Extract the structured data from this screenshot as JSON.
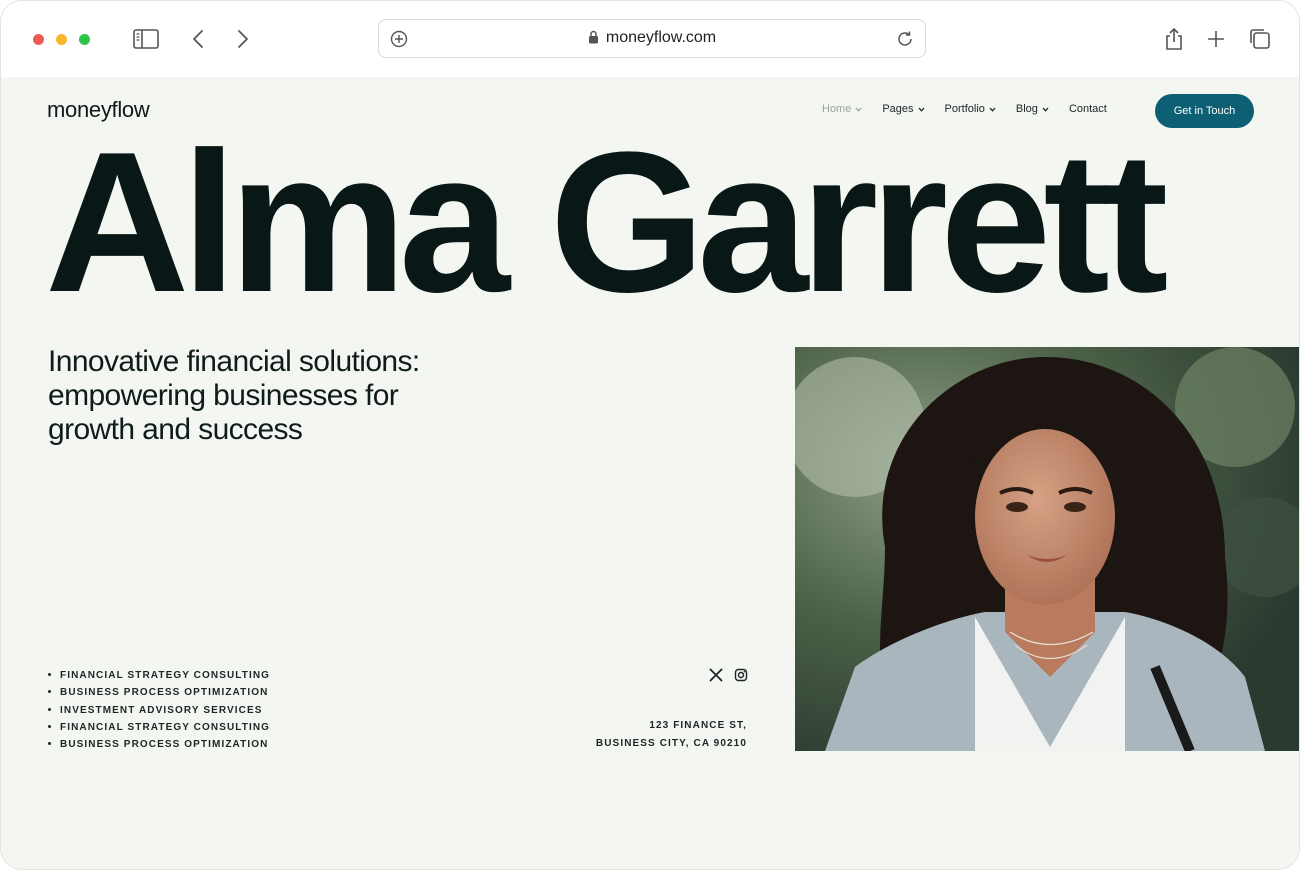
{
  "browser": {
    "url": "moneyflow.com",
    "traffic_colors": [
      "#ee5b52",
      "#f6b72c",
      "#2fc548"
    ]
  },
  "site": {
    "logo": "moneyflow",
    "nav": [
      {
        "label": "Home",
        "dropdown": true,
        "active": true
      },
      {
        "label": "Pages",
        "dropdown": true
      },
      {
        "label": "Portfolio",
        "dropdown": true
      },
      {
        "label": "Blog",
        "dropdown": true
      },
      {
        "label": "Contact",
        "dropdown": false
      }
    ],
    "cta_label": "Get in Touch",
    "accent": "#0d5f73",
    "background": "#f4f7f1"
  },
  "hero": {
    "name": "Alma Garrett",
    "tagline_lines": [
      "Innovative financial solutions:",
      "empowering businesses for",
      "growth and success"
    ]
  },
  "services": [
    "FINANCIAL STRATEGY CONSULTING",
    "BUSINESS PROCESS OPTIMIZATION",
    "INVESTMENT ADVISORY SERVICES",
    "FINANCIAL STRATEGY CONSULTING",
    "BUSINESS PROCESS OPTIMIZATION"
  ],
  "social_icons": [
    "x-icon",
    "instagram-icon"
  ],
  "address": {
    "line1": "123 FINANCE ST,",
    "line2": "BUSINESS CITY, CA 90210"
  }
}
